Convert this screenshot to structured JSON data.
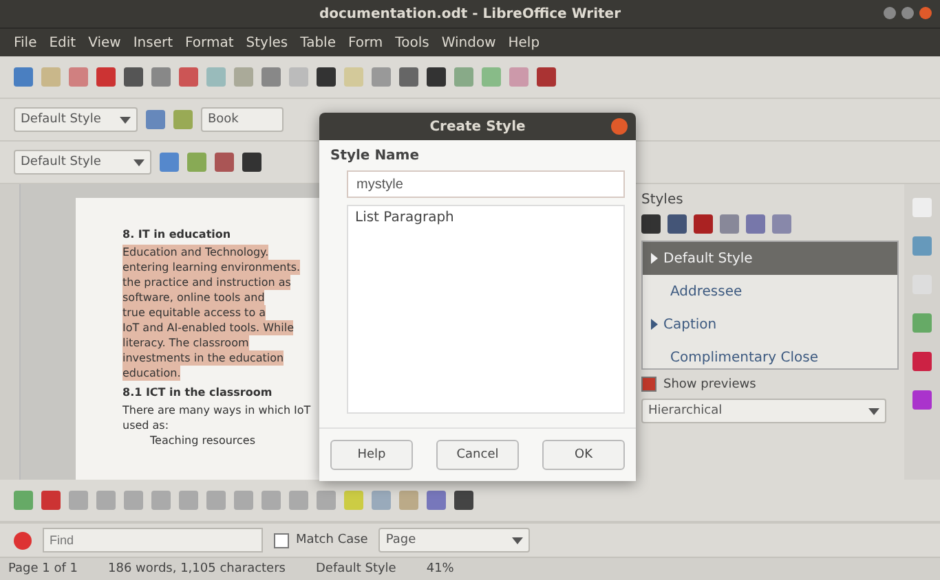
{
  "window": {
    "title": "documentation.odt - LibreOffice Writer"
  },
  "menu": [
    "File",
    "Edit",
    "View",
    "Insert",
    "Format",
    "Styles",
    "Table",
    "Form",
    "Tools",
    "Window",
    "Help"
  ],
  "toolbar_2": {
    "style_box": "Default Style",
    "font_box": "Book"
  },
  "toolbar_3": {
    "style_box": "Default Style"
  },
  "document": {
    "heading": "8. IT in education",
    "paragraph": [
      "Education and Technology.",
      "entering learning environments.",
      "the practice and instruction as",
      "software, online tools and",
      "true equitable access to a",
      "IoT and AI-enabled tools. While",
      "literacy. The classroom",
      "investments in the education",
      "education."
    ],
    "subheading": "8.1 ICT in the classroom",
    "body": [
      "There are many ways in which IoT",
      "used as:"
    ],
    "bullet": "Teaching resources"
  },
  "dialog": {
    "title": "Create Style",
    "label": "Style Name",
    "value": "mystyle",
    "styles": [
      {
        "label": "List Paragraph",
        "selected": false
      }
    ],
    "buttons": [
      "Help",
      "Cancel",
      "OK"
    ]
  },
  "sidebar": {
    "title": "Styles",
    "styles": [
      {
        "label": "Default Style",
        "selected": true,
        "expandable": true
      },
      {
        "label": "Addressee",
        "selected": false,
        "expandable": false
      },
      {
        "label": "Caption",
        "selected": false,
        "expandable": true
      },
      {
        "label": "Complimentary Close",
        "selected": false,
        "expandable": false
      }
    ],
    "show_previews": {
      "label": "Show previews",
      "checked": true
    },
    "filter": "Hierarchical"
  },
  "find_bar": {
    "placeholder": "Find",
    "match_case": {
      "label": "Match Case",
      "checked": false
    },
    "scope": "Page"
  },
  "status_bar": [
    "Page 1 of 1",
    "186 words, 1,105 characters",
    "Default Style",
    "41%"
  ]
}
